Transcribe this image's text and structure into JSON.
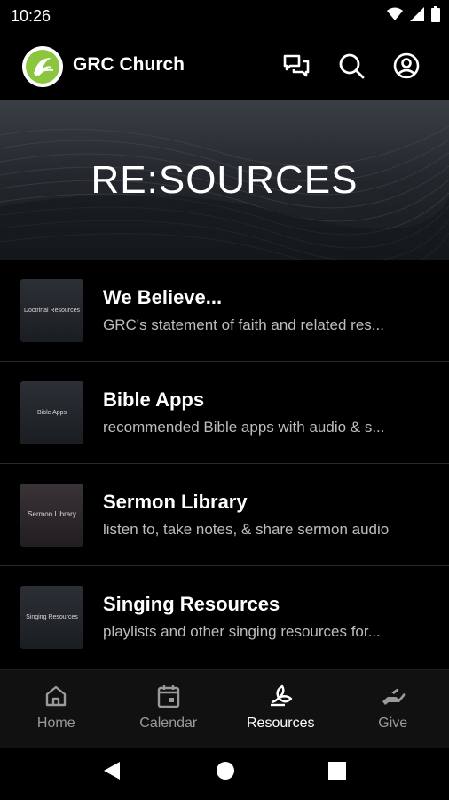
{
  "status_bar": {
    "time": "10:26"
  },
  "app_bar": {
    "title": "GRC Church",
    "logo_icon": "grc-logo-icon",
    "actions": [
      "chat-icon",
      "search-icon",
      "account-icon"
    ]
  },
  "hero": {
    "title": "RE:SOURCES"
  },
  "resources": [
    {
      "title": "We Believe...",
      "subtitle": "GRC's statement of faith and related res...",
      "thumb_text": "Doctrinal Resources"
    },
    {
      "title": "Bible Apps",
      "subtitle": "recommended Bible apps with audio & s...",
      "thumb_text": "Bible Apps"
    },
    {
      "title": "Sermon Library",
      "subtitle": "listen to, take notes, & share sermon audio",
      "thumb_text": "Sermon Library"
    },
    {
      "title": "Singing Resources",
      "subtitle": "playlists and other singing resources for...",
      "thumb_text": "Singing Resources"
    }
  ],
  "bottom_nav": [
    {
      "label": "Home",
      "icon": "home-icon",
      "active": false
    },
    {
      "label": "Calendar",
      "icon": "calendar-icon",
      "active": false
    },
    {
      "label": "Resources",
      "icon": "resources-leaf-icon",
      "active": true
    },
    {
      "label": "Give",
      "icon": "give-hand-icon",
      "active": false
    }
  ],
  "colors": {
    "background": "#000000",
    "nav_background": "#111111",
    "active": "#ffffff",
    "inactive": "#9a9a9a"
  }
}
